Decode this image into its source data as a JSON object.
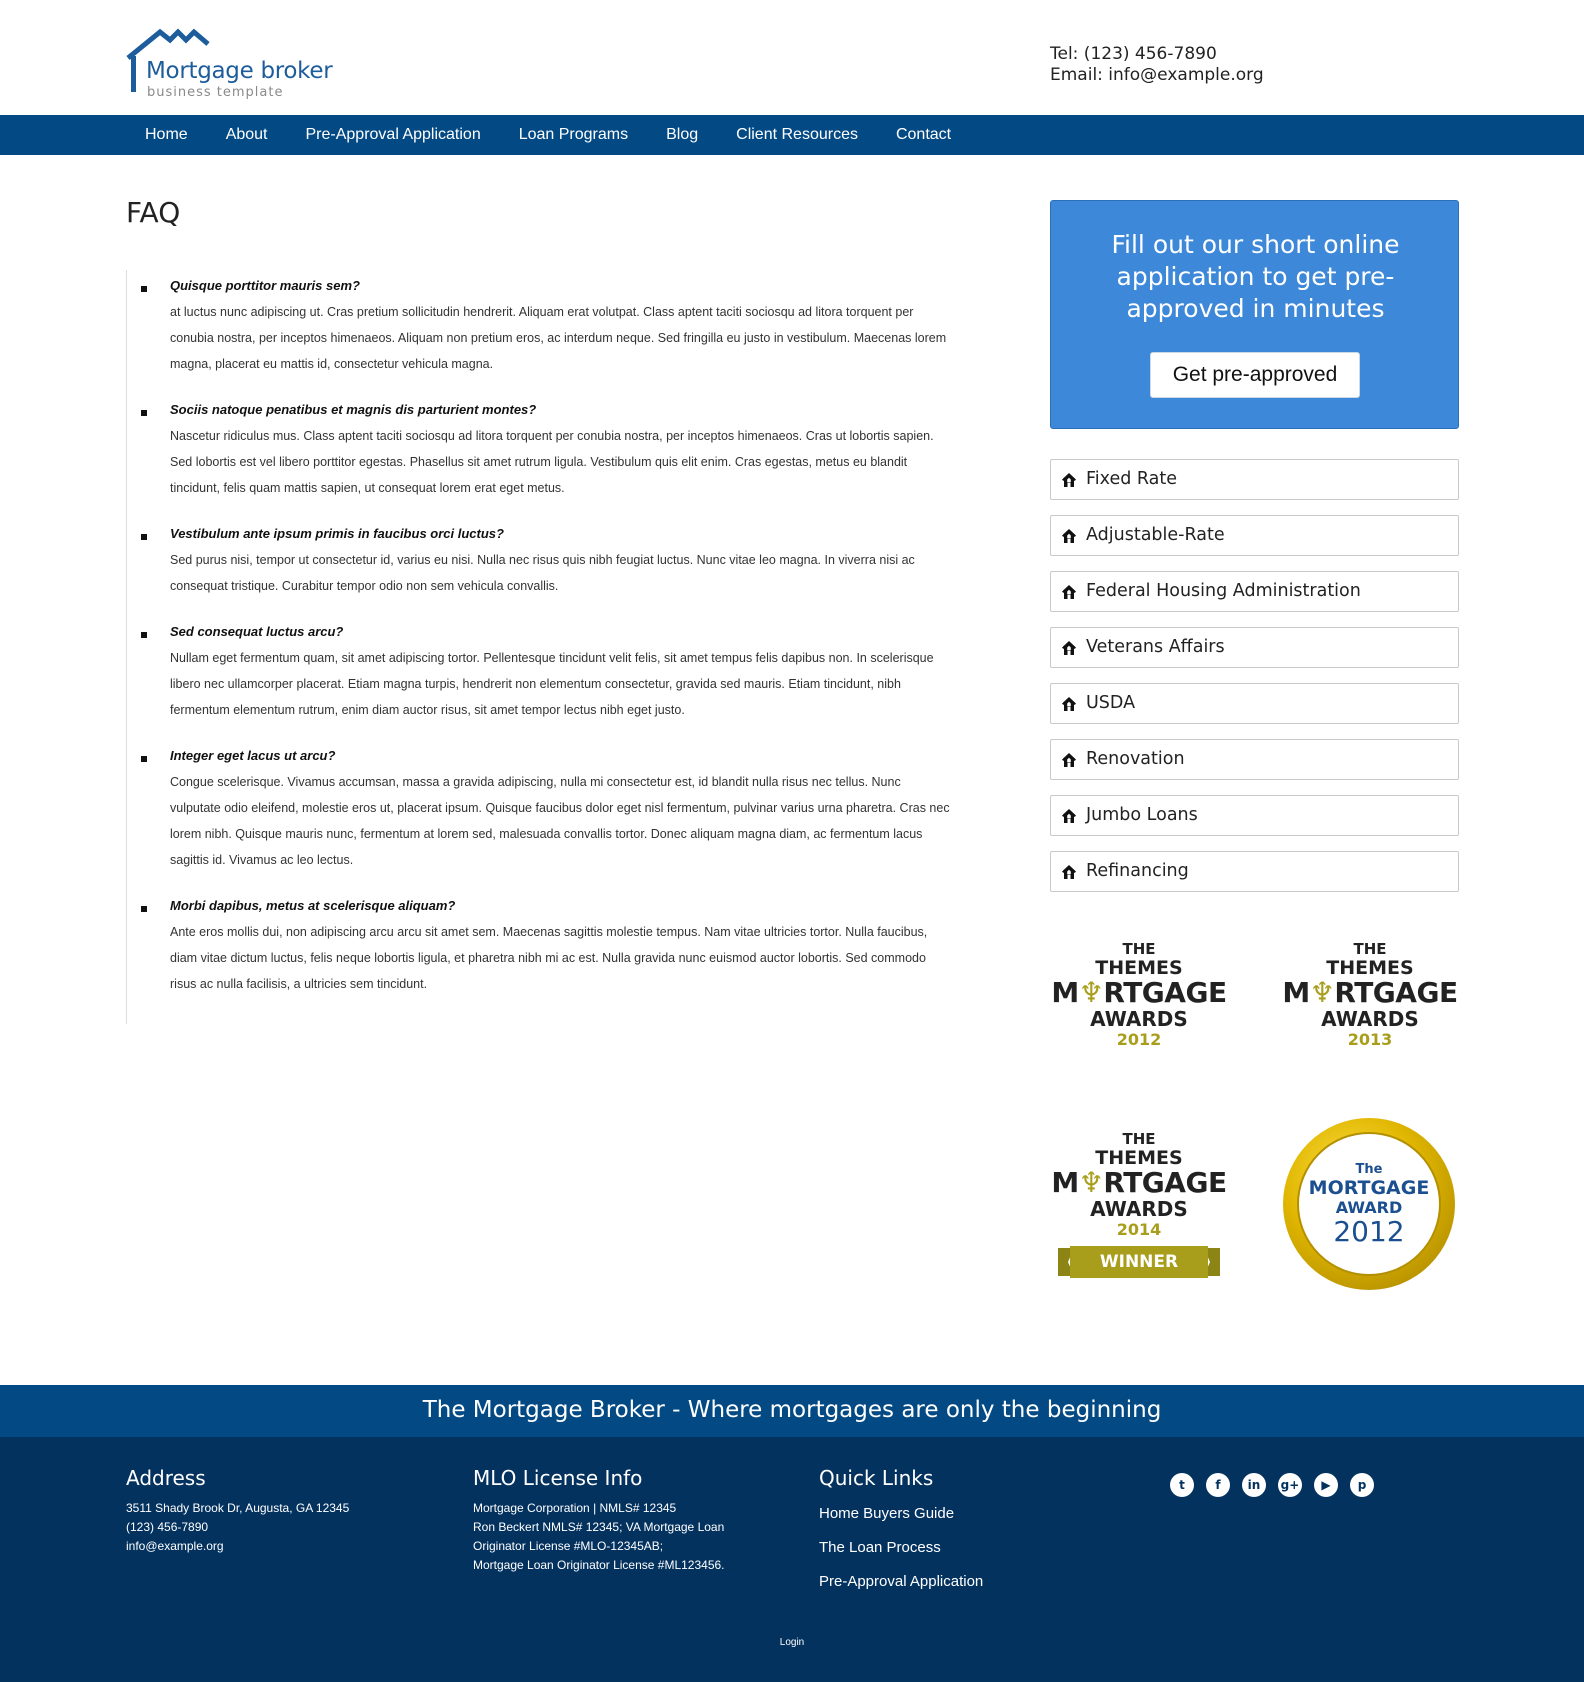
{
  "header": {
    "logo_title": "Mortgage broker",
    "logo_subtitle": "business template",
    "phone": "Tel: (123) 456-7890",
    "email": "Email: info@example.org"
  },
  "nav": {
    "items": [
      {
        "label": "Home"
      },
      {
        "label": "About"
      },
      {
        "label": "Pre-Approval Application"
      },
      {
        "label": "Loan Programs"
      },
      {
        "label": "Blog"
      },
      {
        "label": "Client Resources"
      },
      {
        "label": "Contact"
      }
    ]
  },
  "main": {
    "title": "FAQ",
    "faqs": [
      {
        "question": "Quisque porttitor mauris sem?",
        "answer_lines": [
          "at luctus nunc adipiscing ut. Cras pretium sollicitudin hendrerit. Aliquam erat volutpat. Class aptent taciti sociosqu ad litora torquent per",
          "conubia nostra, per inceptos himenaeos. Aliquam non pretium eros, ac interdum neque. Sed fringilla eu justo in vestibulum. Maecenas lorem",
          "magna, placerat eu mattis id, consectetur vehicula magna."
        ]
      },
      {
        "question": "Sociis natoque penatibus et magnis dis parturient montes?",
        "answer_lines": [
          "Nascetur ridiculus mus. Class aptent taciti sociosqu ad litora torquent per conubia nostra, per inceptos himenaeos. Cras ut lobortis sapien.",
          "Sed lobortis est vel libero porttitor egestas. Phasellus sit amet rutrum ligula. Vestibulum quis elit enim. Cras egestas, metus eu blandit",
          "tincidunt, felis quam mattis sapien, ut consequat lorem erat eget metus."
        ]
      },
      {
        "question": "Vestibulum ante ipsum primis in faucibus orci luctus?",
        "answer_lines": [
          "Sed purus nisi, tempor ut consectetur id, varius eu nisi. Nulla nec risus quis nibh feugiat luctus. Nunc vitae leo magna. In viverra nisi ac",
          "consequat tristique. Curabitur tempor odio non sem vehicula convallis."
        ]
      },
      {
        "question": "Sed consequat luctus arcu?",
        "answer_lines": [
          "Nullam eget fermentum quam, sit amet adipiscing tortor. Pellentesque tincidunt velit felis, sit amet tempus felis dapibus non. In scelerisque",
          "libero nec ullamcorper placerat. Etiam magna turpis, hendrerit non elementum consectetur, gravida sed mauris. Etiam tincidunt, nibh",
          "fermentum elementum rutrum, enim diam auctor risus, sit amet tempor lectus nibh eget justo."
        ]
      },
      {
        "question": "Integer eget lacus ut arcu?",
        "answer_lines": [
          "Congue scelerisque. Vivamus accumsan, massa a gravida adipiscing, nulla mi consectetur est, id blandit nulla risus nec tellus. Nunc",
          "vulputate odio eleifend, molestie eros ut, placerat ipsum. Quisque faucibus dolor eget nisl fermentum, pulvinar varius urna pharetra. Cras nec",
          "lorem nibh. Quisque mauris nunc, fermentum at lorem sed, malesuada convallis tortor. Donec aliquam magna diam, ac fermentum lacus",
          "sagittis id. Vivamus ac leo lectus."
        ]
      },
      {
        "question": "Morbi dapibus, metus at scelerisque aliquam?",
        "answer_lines": [
          "Ante eros mollis dui, non adipiscing arcu arcu sit amet sem. Maecenas sagittis molestie tempus. Nam vitae ultricies tortor. Nulla faucibus,",
          "diam vitae dictum luctus, felis neque lobortis ligula, et pharetra nibh mi ac est. Nulla gravida nunc euismod auctor lobortis. Sed commodo",
          "risus ac nulla facilisis, a ultricies sem tincidunt."
        ]
      }
    ]
  },
  "sidebar": {
    "cta_lines": [
      "Fill out our short online",
      "application to get pre-",
      "approved in minutes"
    ],
    "cta_button": "Get pre-approved",
    "programs": [
      {
        "label": "Fixed Rate"
      },
      {
        "label": "Adjustable-Rate"
      },
      {
        "label": "Federal Housing Administration"
      },
      {
        "label": "Veterans Affairs"
      },
      {
        "label": "USDA"
      },
      {
        "label": "Renovation"
      },
      {
        "label": "Jumbo Loans"
      },
      {
        "label": "Refinancing"
      }
    ],
    "awards": [
      {
        "the": "THE",
        "themes": "THEMES",
        "m": "M",
        "trophy": "♆",
        "rtgage": "RTGAGE",
        "awards": "AWARDS",
        "year": "2012"
      },
      {
        "the": "THE",
        "themes": "THEMES",
        "m": "M",
        "trophy": "♆",
        "rtgage": "RTGAGE",
        "awards": "AWARDS",
        "year": "2013"
      },
      {
        "the": "THE",
        "themes": "THEMES",
        "m": "M",
        "trophy": "♆",
        "rtgage": "RTGAGE",
        "awards": "AWARDS",
        "year": "2014",
        "ribbon": "WINNER"
      }
    ],
    "gold_award": {
      "the": "The",
      "mortgage": "MORTGAGE",
      "award": "AWARD",
      "year": "2012"
    }
  },
  "footer": {
    "tagline": "The Mortgage Broker - Where mortgages are only the beginning",
    "address": {
      "heading": "Address",
      "lines": [
        "3511 Shady Brook Dr, Augusta, GA 12345",
        "(123) 456-7890",
        "info@example.org"
      ]
    },
    "license": {
      "heading": "MLO License Info",
      "lines": [
        "Mortgage Corporation | NMLS# 12345",
        "Ron Beckert NMLS# 12345; VA Mortgage Loan",
        "Originator License #MLO-12345AB;",
        "Mortgage Loan Originator License #ML123456."
      ]
    },
    "quick_links": {
      "heading": "Quick Links",
      "links": [
        "Home Buyers Guide",
        "The Loan Process",
        "Pre-Approval Application"
      ]
    },
    "social": [
      {
        "icon": "twitter-icon",
        "glyph": "t"
      },
      {
        "icon": "facebook-icon",
        "glyph": "f"
      },
      {
        "icon": "linkedin-icon",
        "glyph": "in"
      },
      {
        "icon": "google-plus-icon",
        "glyph": "g+"
      },
      {
        "icon": "youtube-icon",
        "glyph": "▶"
      },
      {
        "icon": "pinterest-icon",
        "glyph": "p"
      }
    ],
    "login": "Login"
  },
  "colors": {
    "nav_blue": "#034a85",
    "footer_blue": "#04325f",
    "cta_blue": "#3e88d9",
    "award_gold": "#a89e1c"
  }
}
